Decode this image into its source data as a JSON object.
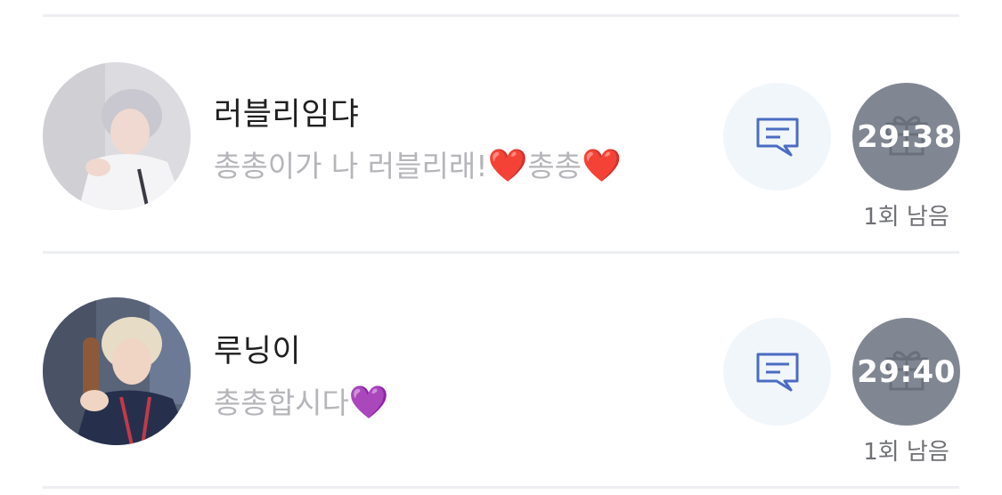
{
  "friends": [
    {
      "name": "러블리임댜",
      "message": "총총이가 나 러블리래!",
      "message_emoji_1": "❤️",
      "message_mid": "총총",
      "message_emoji_2": "❤️",
      "timer": "29:38",
      "remaining": "1회 남음"
    },
    {
      "name": "루닝이",
      "message": "총총합시다",
      "message_emoji_1": "💜",
      "timer": "29:40",
      "remaining": "1회 남음"
    }
  ],
  "icons": {
    "chat": "chat-bubble-icon",
    "timer_bg": "gift-icon"
  },
  "colors": {
    "chat_icon": "#4a6cc2",
    "chat_bg": "#f1f6fb",
    "timer_bg": "#818792",
    "secondary_text": "#b5b5ba",
    "remaining_text": "#6f7075",
    "divider": "#eeeff1"
  }
}
